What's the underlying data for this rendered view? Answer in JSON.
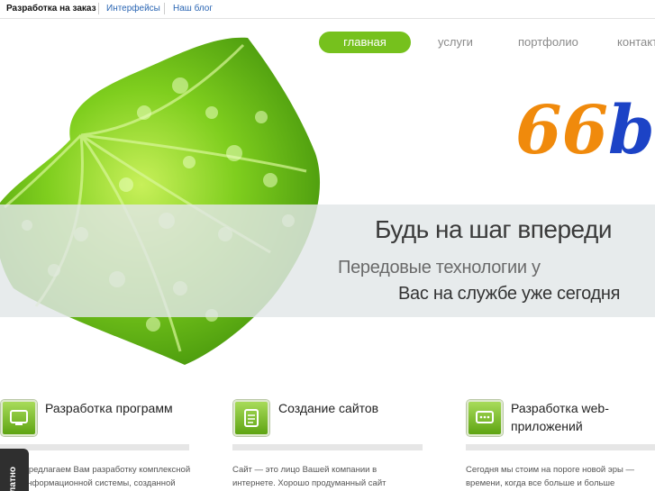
{
  "topbar": {
    "active": "Разработка на заказ",
    "link1": "Интерфейсы",
    "link2": "Наш блог"
  },
  "nav": {
    "home": "главная",
    "services": "услуги",
    "portfolio": "портфолио",
    "contacts": "контакты"
  },
  "logo": {
    "digits": "66",
    "letters": "bi"
  },
  "hero": {
    "headline": "Будь на шаг впереди",
    "sub_line1": "Передовые технологии у",
    "sub_line2": "Вас на службе уже сегодня"
  },
  "services": [
    {
      "title": "Разработка программ",
      "text1": "Предлагаем Вам разработку комплексной",
      "text2": "информационной системы, созданной"
    },
    {
      "title": "Создание сайтов",
      "text1": "Сайт — это лицо Вашей компании в",
      "text2": "интернете. Хорошо продуманный сайт"
    },
    {
      "title_line1": "Разработка web-",
      "title_line2": "приложений",
      "text1": "Сегодня мы стоим на пороге новой эры —",
      "text2": "времени, когда все больше и больше"
    }
  ],
  "feedback": {
    "label": "Бесплатно"
  },
  "colors": {
    "accent": "#76c11d",
    "link": "#2a65b3",
    "logo_orange": "#f08a0c",
    "logo_blue": "#1c43c6"
  },
  "icons": [
    "monitor-icon",
    "document-icon",
    "chat-window-icon",
    "leaf-image"
  ]
}
